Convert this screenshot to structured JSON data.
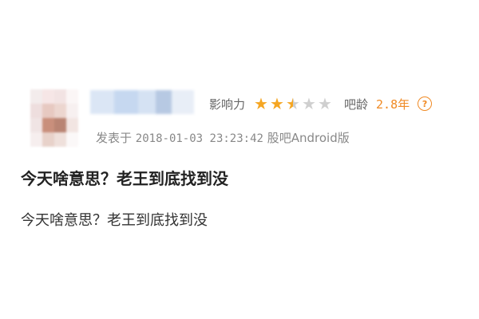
{
  "post": {
    "influence_label": "影响力",
    "influence_rating": 2.5,
    "influence_max": 5,
    "bar_age_label": "吧龄",
    "bar_age_value": "2.8年",
    "posted_prefix": "发表于",
    "posted_time": "2018-01-03 23:23:42",
    "client": "股吧Android版",
    "title": "今天啥意思？老王到底找到没",
    "body": "今天啥意思？老王到底找到没"
  },
  "icons": {
    "help": "help-circle-icon",
    "star": "star-icon"
  },
  "colors": {
    "star_filled": "#f5a623",
    "star_empty": "#cfcfcf",
    "accent_orange": "#f08a24"
  }
}
